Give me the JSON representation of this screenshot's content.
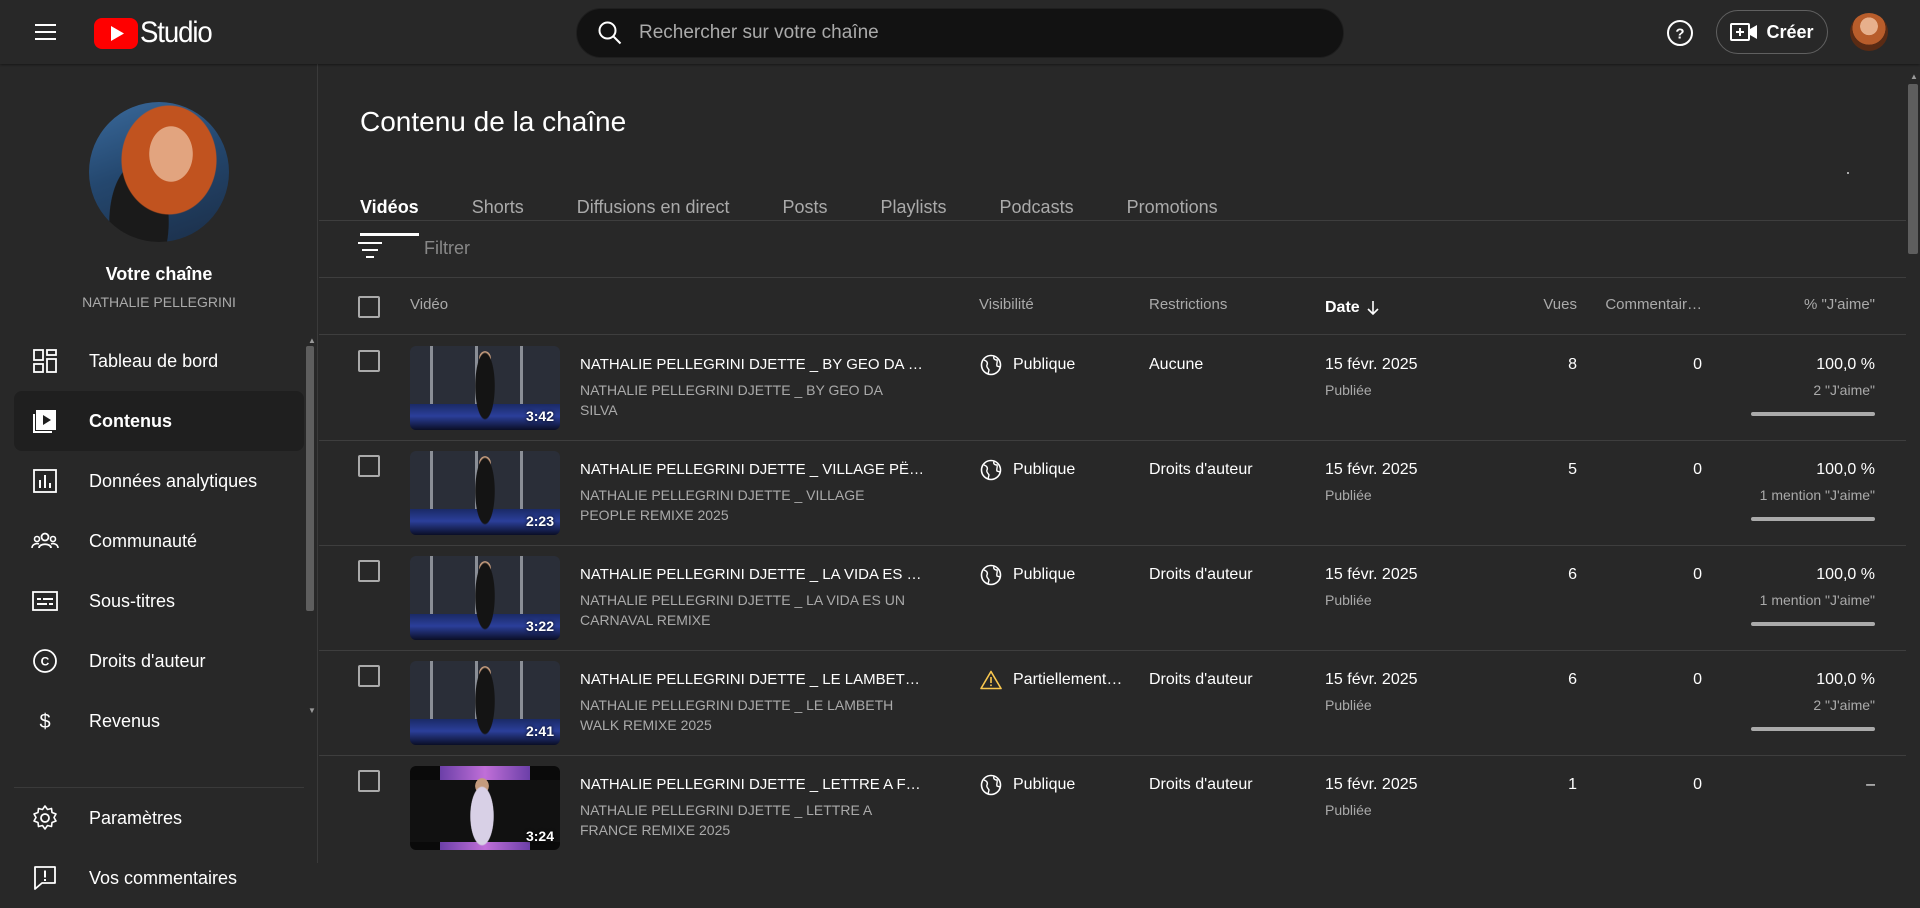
{
  "header": {
    "logo_text": "Studio",
    "search_placeholder": "Rechercher sur votre chaîne",
    "create_label": "Créer"
  },
  "sidebar": {
    "channel_title": "Votre chaîne",
    "channel_name": "NATHALIE PELLEGRINI",
    "items": [
      {
        "label": "Tableau de bord",
        "icon": "dashboard-icon"
      },
      {
        "label": "Contenus",
        "icon": "content-icon",
        "active": true
      },
      {
        "label": "Données analytiques",
        "icon": "analytics-icon"
      },
      {
        "label": "Communauté",
        "icon": "community-icon"
      },
      {
        "label": "Sous-titres",
        "icon": "subtitles-icon"
      },
      {
        "label": "Droits d'auteur",
        "icon": "copyright-icon"
      },
      {
        "label": "Revenus",
        "icon": "earn-icon"
      }
    ],
    "bottom_items": [
      {
        "label": "Paramètres",
        "icon": "settings-icon"
      },
      {
        "label": "Vos commentaires",
        "icon": "feedback-icon"
      }
    ]
  },
  "main": {
    "title": "Contenu de la chaîne",
    "tabs": [
      {
        "label": "Vidéos",
        "active": true
      },
      {
        "label": "Shorts"
      },
      {
        "label": "Diffusions en direct"
      },
      {
        "label": "Posts"
      },
      {
        "label": "Playlists"
      },
      {
        "label": "Podcasts"
      },
      {
        "label": "Promotions"
      }
    ],
    "filter_placeholder": "Filtrer",
    "columns": {
      "video": "Vidéo",
      "visibility": "Visibilité",
      "restrictions": "Restrictions",
      "date": "Date",
      "views": "Vues",
      "comments": "Commentair…",
      "likes": "% \"J'aime\""
    },
    "rows": [
      {
        "duration": "3:42",
        "title": "NATHALIE PELLEGRINI DJETTE _ BY GEO DA …",
        "description": "NATHALIE PELLEGRINI DJETTE _ BY GEO DA SILVA",
        "visibility": "Publique",
        "visibility_icon": "globe-icon",
        "restrictions": "Aucune",
        "date": "15 févr. 2025",
        "date_status": "Publiée",
        "views": "8",
        "comments": "0",
        "likes_pct": "100,0 %",
        "likes_count": "2 \"J'aime\"",
        "likes_bar": true
      },
      {
        "duration": "2:23",
        "title": "NATHALIE PELLEGRINI DJETTE _ VILLAGE PË…",
        "description": "NATHALIE PELLEGRINI DJETTE _ VILLAGE PEOPLE REMIXE 2025",
        "visibility": "Publique",
        "visibility_icon": "globe-icon",
        "restrictions": "Droits d'auteur",
        "date": "15 févr. 2025",
        "date_status": "Publiée",
        "views": "5",
        "comments": "0",
        "likes_pct": "100,0 %",
        "likes_count": "1 mention \"J'aime\"",
        "likes_bar": true
      },
      {
        "duration": "3:22",
        "title": "NATHALIE PELLEGRINI DJETTE _ LA VIDA ES …",
        "description": "NATHALIE PELLEGRINI DJETTE _ LA VIDA ES UN CARNAVAL REMIXE",
        "visibility": "Publique",
        "visibility_icon": "globe-icon",
        "restrictions": "Droits d'auteur",
        "date": "15 févr. 2025",
        "date_status": "Publiée",
        "views": "6",
        "comments": "0",
        "likes_pct": "100,0 %",
        "likes_count": "1 mention \"J'aime\"",
        "likes_bar": true
      },
      {
        "duration": "2:41",
        "title": "NATHALIE PELLEGRINI DJETTE _ LE LAMBET…",
        "description": "NATHALIE PELLEGRINI DJETTE _ LE LAMBETH WALK REMIXE 2025",
        "visibility": "Partiellement…",
        "visibility_icon": "warning-icon",
        "restrictions": "Droits d'auteur",
        "date": "15 févr. 2025",
        "date_status": "Publiée",
        "views": "6",
        "comments": "0",
        "likes_pct": "100,0 %",
        "likes_count": "2 \"J'aime\"",
        "likes_bar": true
      },
      {
        "duration": "3:24",
        "title": "NATHALIE PELLEGRINI DJETTE _ LETTRE A F…",
        "description": "NATHALIE PELLEGRINI DJETTE _ LETTRE A FRANCE REMIXE 2025",
        "visibility": "Publique",
        "visibility_icon": "globe-icon",
        "restrictions": "Droits d'auteur",
        "date": "15 févr. 2025",
        "date_status": "Publiée",
        "views": "1",
        "comments": "0",
        "likes_pct": "–",
        "likes_count": "",
        "likes_bar": false
      }
    ]
  },
  "colors": {
    "background": "#282828",
    "header_bg": "#282828",
    "search_bg": "#121212",
    "accent_red": "#ff0000",
    "secondary_text": "#aaaaaa"
  }
}
